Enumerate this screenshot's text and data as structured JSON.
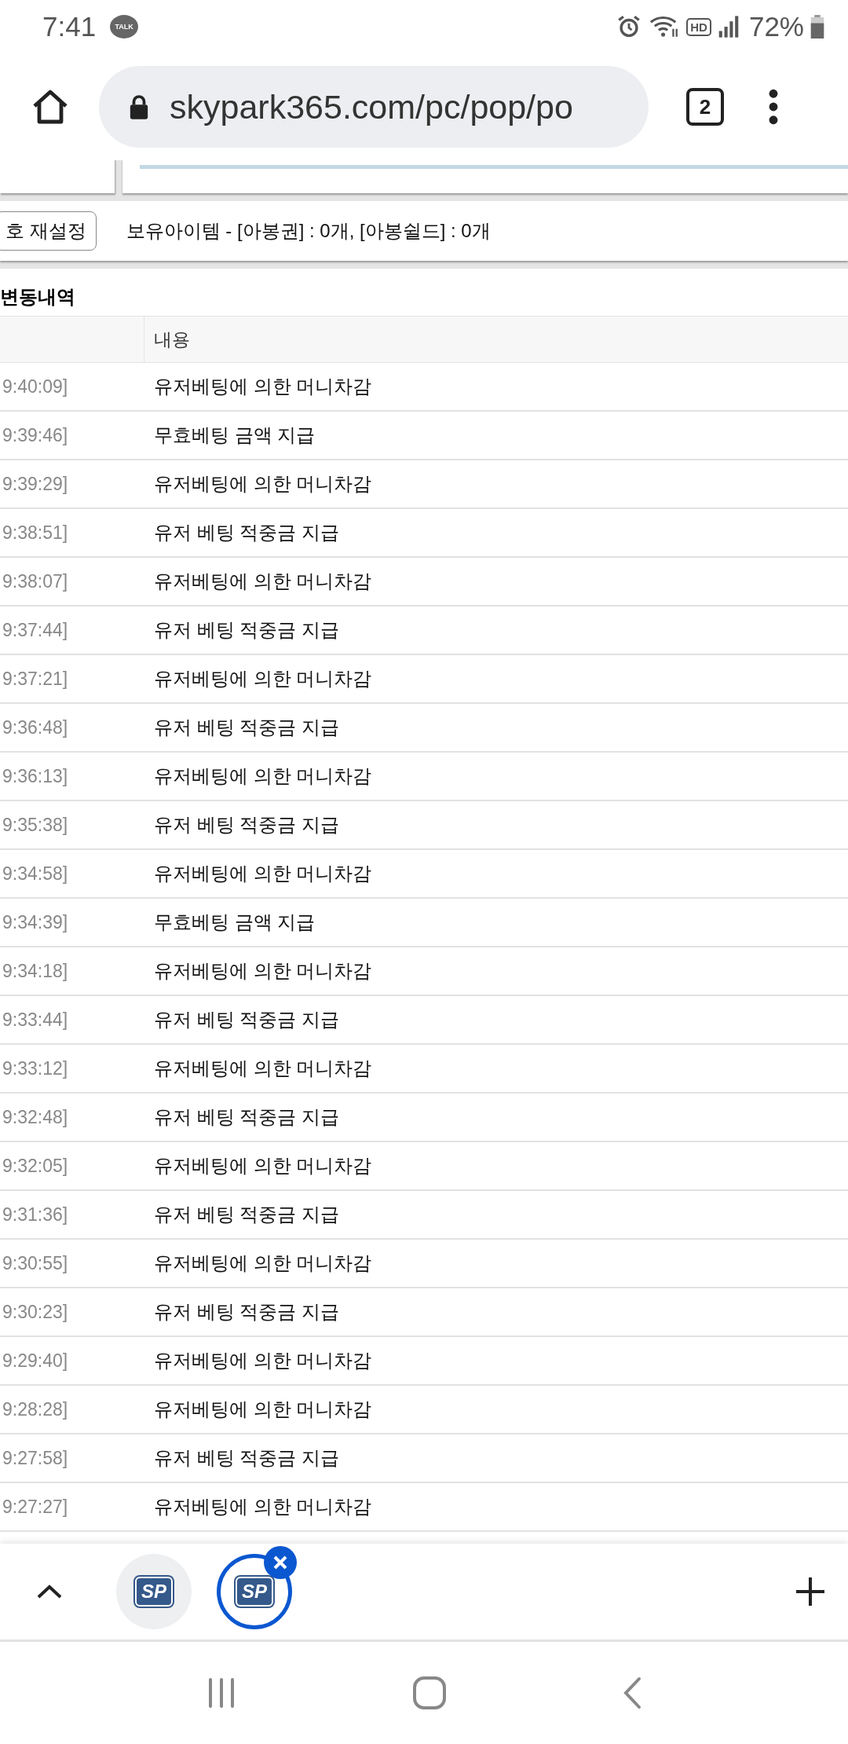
{
  "status_bar": {
    "time": "7:41",
    "talk_badge": "TALK",
    "hd_badge": "HD",
    "battery": "72%"
  },
  "browser": {
    "url": "skypark365.com/pc/pop/po",
    "tab_count": "2"
  },
  "page": {
    "reset_button": "호 재설정",
    "items_info": "보유아이템 - [아봉권] : 0개, [아봉쉴드] : 0개",
    "section_title": "변동내역",
    "table": {
      "columns": [
        "내용"
      ],
      "rows": [
        {
          "time": "9:40:09]",
          "content": "유저베팅에 의한 머니차감"
        },
        {
          "time": "9:39:46]",
          "content": "무효베팅 금액 지급"
        },
        {
          "time": "9:39:29]",
          "content": "유저베팅에 의한 머니차감"
        },
        {
          "time": "9:38:51]",
          "content": "유저 베팅 적중금 지급"
        },
        {
          "time": "9:38:07]",
          "content": "유저베팅에 의한 머니차감"
        },
        {
          "time": "9:37:44]",
          "content": "유저 베팅 적중금 지급"
        },
        {
          "time": "9:37:21]",
          "content": "유저베팅에 의한 머니차감"
        },
        {
          "time": "9:36:48]",
          "content": "유저 베팅 적중금 지급"
        },
        {
          "time": "9:36:13]",
          "content": "유저베팅에 의한 머니차감"
        },
        {
          "time": "9:35:38]",
          "content": "유저 베팅 적중금 지급"
        },
        {
          "time": "9:34:58]",
          "content": "유저베팅에 의한 머니차감"
        },
        {
          "time": "9:34:39]",
          "content": "무효베팅 금액 지급"
        },
        {
          "time": "9:34:18]",
          "content": "유저베팅에 의한 머니차감"
        },
        {
          "time": "9:33:44]",
          "content": "유저 베팅 적중금 지급"
        },
        {
          "time": "9:33:12]",
          "content": "유저베팅에 의한 머니차감"
        },
        {
          "time": "9:32:48]",
          "content": "유저 베팅 적중금 지급"
        },
        {
          "time": "9:32:05]",
          "content": "유저베팅에 의한 머니차감"
        },
        {
          "time": "9:31:36]",
          "content": "유저 베팅 적중금 지급"
        },
        {
          "time": "9:30:55]",
          "content": "유저베팅에 의한 머니차감"
        },
        {
          "time": "9:30:23]",
          "content": "유저 베팅 적중금 지급"
        },
        {
          "time": "9:29:40]",
          "content": "유저베팅에 의한 머니차감"
        },
        {
          "time": "9:28:28]",
          "content": "유저베팅에 의한 머니차감"
        },
        {
          "time": "9:27:58]",
          "content": "유저 베팅 적중금 지급"
        },
        {
          "time": "9:27:27]",
          "content": "유저베팅에 의한 머니차감"
        }
      ]
    }
  },
  "tab_switcher": {
    "tabs": [
      {
        "logo": "SP",
        "selected": false
      },
      {
        "logo": "SP",
        "selected": true
      }
    ]
  }
}
